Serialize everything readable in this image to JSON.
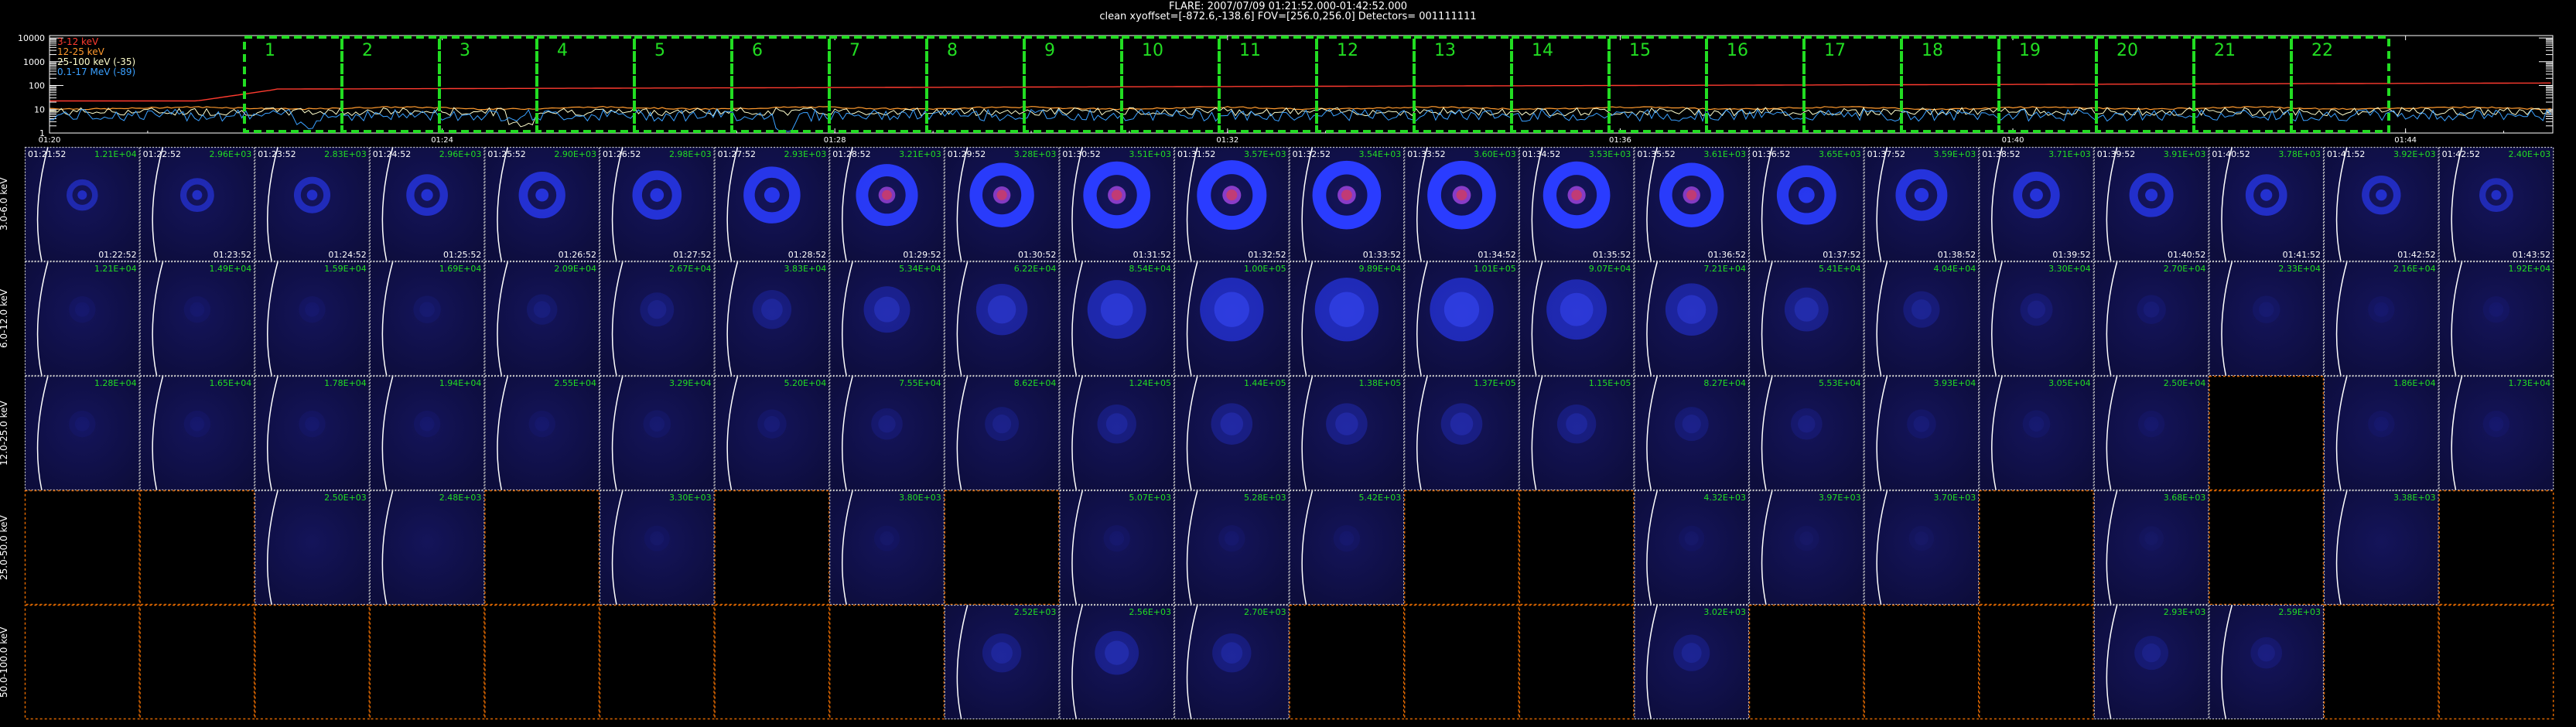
{
  "header": {
    "line1": "FLARE: 2007/07/09  01:21:52.000-01:42:52.000",
    "line2": "clean    xyoffset=[-872.6,-138.6]    FOV=[256.0,256.0]    Detectors= 001111111"
  },
  "lightcurve": {
    "y_ticks": [
      "10000",
      "1000",
      "100",
      "10",
      "1"
    ],
    "x_ticks": [
      "01:20",
      "01:24",
      "01:28",
      "01:32",
      "01:36",
      "01:40",
      "01:44"
    ],
    "legend": [
      {
        "label": "3-12 keV",
        "color": "#ff3b2f"
      },
      {
        "label": "12-25 keV",
        "color": "#ff9a2e"
      },
      {
        "label": "25-100 keV (-35)",
        "color": "#ffffcc"
      },
      {
        "label": "0.1-17 MeV (-89)",
        "color": "#3aa0ff"
      }
    ],
    "interval_numbers": [
      "1",
      "2",
      "3",
      "4",
      "5",
      "6",
      "7",
      "8",
      "9",
      "10",
      "11",
      "12",
      "13",
      "14",
      "15",
      "16",
      "17",
      "18",
      "19",
      "20",
      "21",
      "22"
    ],
    "interval_color": "#22dd22"
  },
  "energy_bands": [
    "3.0-6.0 keV",
    "6.0-12.0 keV",
    "12.0-25.0 keV",
    "25.0-50.0 keV",
    "50.0-100.0 keV"
  ],
  "time_starts": [
    "01:21:52",
    "01:22:52",
    "01:23:52",
    "01:24:52",
    "01:25:52",
    "01:26:52",
    "01:27:52",
    "01:28:52",
    "01:29:52",
    "01:30:52",
    "01:31:52",
    "01:32:52",
    "01:33:52",
    "01:34:52",
    "01:35:52",
    "01:36:52",
    "01:37:52",
    "01:38:52",
    "01:39:52",
    "01:40:52",
    "01:41:52",
    "01:42:52"
  ],
  "time_ends": [
    "01:22:52",
    "01:23:52",
    "01:24:52",
    "01:25:52",
    "01:26:52",
    "01:27:52",
    "01:28:52",
    "01:29:52",
    "01:30:52",
    "01:31:52",
    "01:32:52",
    "01:33:52",
    "01:34:52",
    "01:35:52",
    "01:36:52",
    "01:37:52",
    "01:38:52",
    "01:39:52",
    "01:40:52",
    "01:41:52",
    "01:42:52",
    "01:43:52"
  ],
  "peaks": [
    [
      "1.21E+04",
      "2.96E+03",
      "2.83E+03",
      "2.96E+03",
      "2.90E+03",
      "2.98E+03",
      "2.93E+03",
      "3.21E+03",
      "3.28E+03",
      "3.51E+03",
      "3.57E+03",
      "3.54E+03",
      "3.60E+03",
      "3.53E+03",
      "3.61E+03",
      "3.65E+03",
      "3.59E+03",
      "3.71E+03",
      "3.91E+03",
      "3.78E+03",
      "3.92E+03",
      "2.40E+03"
    ],
    [
      "1.21E+04",
      "1.49E+04",
      "1.59E+04",
      "1.69E+04",
      "2.09E+04",
      "2.67E+04",
      "3.83E+04",
      "5.34E+04",
      "6.22E+04",
      "8.54E+04",
      "1.00E+05",
      "9.89E+04",
      "1.01E+05",
      "9.07E+04",
      "7.21E+04",
      "5.41E+04",
      "4.04E+04",
      "3.30E+04",
      "2.70E+04",
      "2.33E+04",
      "2.16E+04",
      "1.92E+04"
    ],
    [
      "1.28E+04",
      "1.65E+04",
      "1.78E+04",
      "1.94E+04",
      "2.55E+04",
      "3.29E+04",
      "5.20E+04",
      "7.55E+04",
      "8.62E+04",
      "1.24E+05",
      "1.44E+05",
      "1.38E+05",
      "1.37E+05",
      "1.15E+05",
      "8.27E+04",
      "5.53E+04",
      "3.93E+04",
      "3.05E+04",
      "2.50E+04",
      "",
      "1.86E+04",
      "1.73E+04"
    ],
    [
      "",
      "",
      "2.50E+03",
      "2.48E+03",
      "",
      "3.30E+03",
      "",
      "3.80E+03",
      "",
      "5.07E+03",
      "5.28E+03",
      "5.42E+03",
      "",
      "",
      "4.32E+03",
      "3.97E+03",
      "3.70E+03",
      "",
      "3.68E+03",
      "",
      "3.38E+03",
      ""
    ],
    [
      "",
      "",
      "",
      "",
      "",
      "",
      "",
      "",
      "2.52E+03",
      "2.56E+03",
      "2.70E+03",
      "",
      "",
      "",
      "3.02E+03",
      "",
      "",
      "",
      "2.93E+03",
      "2.59E+03",
      "",
      ""
    ]
  ],
  "cell_state": [
    [
      "img",
      "img",
      "img",
      "img",
      "img",
      "img",
      "img",
      "img",
      "img",
      "img",
      "img",
      "img",
      "img",
      "img",
      "img",
      "img",
      "img",
      "img",
      "img",
      "img",
      "img",
      "img"
    ],
    [
      "img",
      "img",
      "img",
      "img",
      "img",
      "img",
      "img",
      "img",
      "img",
      "img",
      "img",
      "img",
      "img",
      "img",
      "img",
      "img",
      "img",
      "img",
      "img",
      "img",
      "img",
      "img"
    ],
    [
      "img",
      "img",
      "img",
      "img",
      "img",
      "img",
      "img",
      "img",
      "img",
      "img",
      "img",
      "img",
      "img",
      "img",
      "img",
      "img",
      "img",
      "img",
      "img",
      "empty",
      "img",
      "img"
    ],
    [
      "empty",
      "empty",
      "img",
      "img",
      "empty",
      "img",
      "empty",
      "img",
      "empty",
      "img",
      "img",
      "img",
      "empty",
      "empty",
      "img",
      "img",
      "img",
      "empty",
      "img",
      "empty",
      "img",
      "empty"
    ],
    [
      "empty",
      "empty",
      "empty",
      "empty",
      "empty",
      "empty",
      "empty",
      "empty",
      "img",
      "img",
      "img",
      "empty",
      "empty",
      "empty",
      "img",
      "empty",
      "empty",
      "empty",
      "img",
      "img",
      "empty",
      "empty"
    ]
  ],
  "source_brightness": [
    [
      0.25,
      0.3,
      0.35,
      0.45,
      0.55,
      0.6,
      0.75,
      0.85,
      0.9,
      0.95,
      1.0,
      0.98,
      0.98,
      0.95,
      0.9,
      0.8,
      0.65,
      0.55,
      0.5,
      0.45,
      0.4,
      0.3
    ],
    [
      0.1,
      0.1,
      0.1,
      0.12,
      0.18,
      0.25,
      0.35,
      0.5,
      0.6,
      0.75,
      0.85,
      0.85,
      0.85,
      0.78,
      0.62,
      0.45,
      0.3,
      0.22,
      0.15,
      0.12,
      0.1,
      0.1
    ],
    [
      0.1,
      0.1,
      0.1,
      0.1,
      0.1,
      0.12,
      0.15,
      0.2,
      0.25,
      0.35,
      0.4,
      0.4,
      0.4,
      0.35,
      0.25,
      0.2,
      0.15,
      0.12,
      0.1,
      0.0,
      0.1,
      0.1
    ],
    [
      0,
      0,
      0.05,
      0.05,
      0,
      0.08,
      0,
      0.08,
      0,
      0.1,
      0.1,
      0.1,
      0,
      0,
      0.08,
      0.07,
      0.07,
      0,
      0.06,
      0,
      0.05,
      0
    ],
    [
      0,
      0,
      0,
      0,
      0,
      0,
      0,
      0,
      0.35,
      0.45,
      0.35,
      0,
      0,
      0,
      0.3,
      0,
      0,
      0,
      0.25,
      0.2,
      0,
      0
    ]
  ],
  "colors": {
    "peak_text": "#22dd22",
    "img_border": "#c8c8c8",
    "empty_border": "#dd6600",
    "limb": "#ffffff"
  }
}
